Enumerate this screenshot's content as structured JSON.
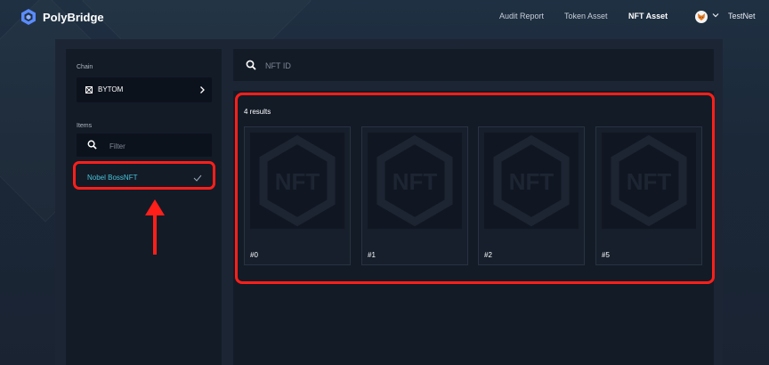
{
  "app": {
    "name": "PolyBridge"
  },
  "nav": {
    "items": [
      {
        "label": "Audit Report",
        "active": false
      },
      {
        "label": "Token Asset",
        "active": false
      },
      {
        "label": "NFT Asset",
        "active": true
      }
    ]
  },
  "wallet": {
    "icon": "fox-icon",
    "network": "TestNet"
  },
  "sidebar": {
    "chain_label": "Chain",
    "chain_value": "BYTOM",
    "items_label": "Items",
    "filter_placeholder": "Filter",
    "items": [
      {
        "label": "Nobel BossNFT",
        "selected": true
      }
    ]
  },
  "search": {
    "placeholder": "NFT ID"
  },
  "results": {
    "count_text": "4 results",
    "cards": [
      {
        "label": "#0",
        "image_text": "NFT"
      },
      {
        "label": "#1",
        "image_text": "NFT"
      },
      {
        "label": "#2",
        "image_text": "NFT"
      },
      {
        "label": "#5",
        "image_text": "NFT"
      }
    ]
  },
  "colors": {
    "accent": "#49c3d8",
    "highlight": "#ff1f1a",
    "panel": "#1c2534",
    "card_bg": "#131b27"
  }
}
